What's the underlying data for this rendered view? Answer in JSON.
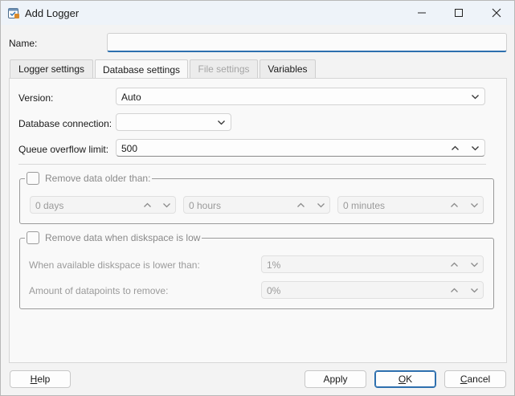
{
  "window": {
    "title": "Add Logger",
    "icon": "logger-app-icon",
    "controls": [
      "minimize-icon",
      "maximize-icon",
      "close-icon"
    ]
  },
  "name": {
    "label": "Name:",
    "value": ""
  },
  "tabs": [
    {
      "label": "Logger settings",
      "state": "normal"
    },
    {
      "label": "Database settings",
      "state": "active"
    },
    {
      "label": "File settings",
      "state": "disabled"
    },
    {
      "label": "Variables",
      "state": "normal"
    }
  ],
  "database": {
    "version": {
      "label": "Version:",
      "value": "Auto"
    },
    "connection": {
      "label": "Database connection:",
      "value": ""
    },
    "queue_overflow": {
      "label": "Queue overflow limit:",
      "value": "500"
    }
  },
  "remove_older": {
    "label": "Remove data older than:",
    "checked": false,
    "days": "0 days",
    "hours": "0 hours",
    "minutes": "0 minutes"
  },
  "remove_diskspace": {
    "label": "Remove data when diskspace is low",
    "checked": false,
    "lower_than_label": "When available diskspace is lower than:",
    "lower_than_value": "1%",
    "datapoints_label": "Amount of datapoints to remove:",
    "datapoints_value": "0%"
  },
  "buttons": {
    "help": "Help",
    "apply": "Apply",
    "ok": "OK",
    "cancel": "Cancel"
  },
  "colors": {
    "accent": "#2d6fae",
    "titlebar": "#eef3f9",
    "disabled_text": "#9a9a9a"
  }
}
